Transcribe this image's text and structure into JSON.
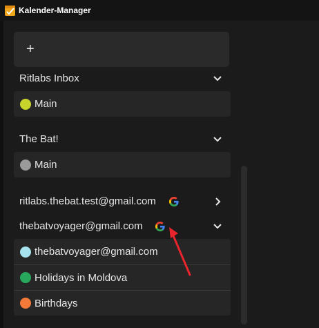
{
  "window": {
    "title": "Kalender-Manager"
  },
  "toolbar": {
    "add_label": "+"
  },
  "groups": [
    {
      "name": "Ritlabs Inbox",
      "expanded": true,
      "calendars": [
        {
          "name": "Main",
          "color": "#c8d42c"
        }
      ]
    },
    {
      "name": "The Bat!",
      "expanded": true,
      "calendars": [
        {
          "name": "Main",
          "color": "#9a9a9a"
        }
      ]
    },
    {
      "name": "ritlabs.thebat.test@gmail.com",
      "expanded": false,
      "provider_icon": "google-icon",
      "calendars": []
    },
    {
      "name": "thebatvoyager@gmail.com",
      "expanded": true,
      "provider_icon": "google-icon",
      "calendars": [
        {
          "name": "thebatvoyager@gmail.com",
          "color": "#a6e3ee"
        },
        {
          "name": "Holidays in Moldova",
          "color": "#27a85c"
        },
        {
          "name": "Birthdays",
          "color": "#f47a3a"
        }
      ]
    }
  ],
  "colors": {
    "background": "#1b1b1b",
    "card": "#262626",
    "titlebar": "#141414",
    "annotation_arrow": "#e8242c"
  }
}
